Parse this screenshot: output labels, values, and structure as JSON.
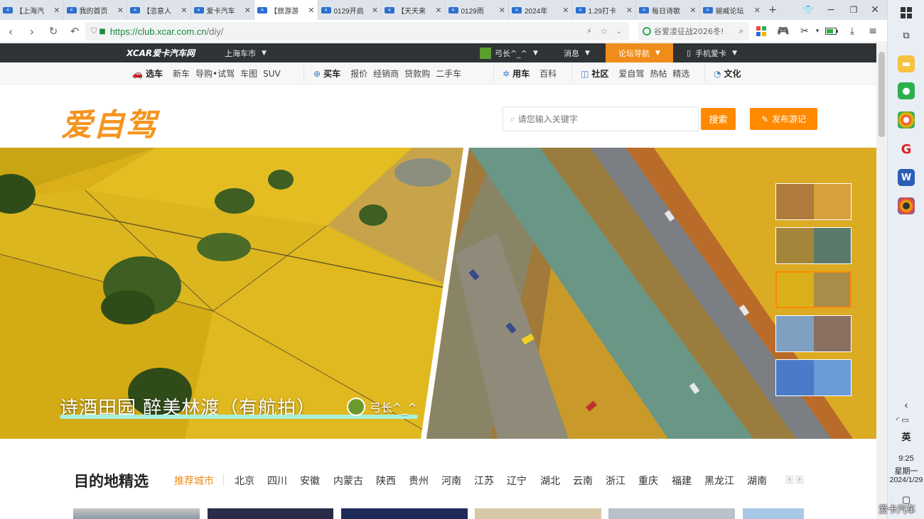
{
  "browser": {
    "tabs": [
      {
        "label": "【上海汽",
        "active": false
      },
      {
        "label": "我的首页",
        "active": false
      },
      {
        "label": "【恣意人",
        "active": false
      },
      {
        "label": "爱卡汽车",
        "active": false
      },
      {
        "label": "【旅游游",
        "active": true
      },
      {
        "label": "0129开启",
        "active": false
      },
      {
        "label": "【天天来",
        "active": false
      },
      {
        "label": "0129雨",
        "active": false
      },
      {
        "label": "2024年",
        "active": false
      },
      {
        "label": "1.29打卡",
        "active": false
      },
      {
        "label": "每日诗歌",
        "active": false
      },
      {
        "label": "骊威论坛",
        "active": false
      }
    ],
    "url_scheme_host": "https://club.xcar.com.cn",
    "url_path": "/diy/",
    "search_placeholder": "谷爱凌征战2026冬!"
  },
  "site": {
    "logo_text": "XCAR爱卡汽车网",
    "city": "上海车市",
    "user": "弓长^_^",
    "messages": "消息",
    "forum_nav": "论坛导航",
    "mobile": "手机爱卡",
    "categories": [
      {
        "head": "选车",
        "links": [
          "新车",
          "导购•试驾",
          "车图",
          "SUV"
        ]
      },
      {
        "head": "买车",
        "links": [
          "报价",
          "经销商",
          "贷款购",
          "二手车"
        ]
      },
      {
        "head": "用车",
        "links": [
          "百科"
        ]
      },
      {
        "head": "社区",
        "links": [
          "爱自驾",
          "热帖",
          "精选"
        ]
      },
      {
        "head": "文化",
        "links": []
      }
    ]
  },
  "header": {
    "brand": "爱自驾",
    "keyword_placeholder": "请您输入关键字",
    "search_btn": "搜索",
    "post_btn": "发布游记"
  },
  "hero": {
    "title": "诗酒田园 醉美林渡（有航拍）",
    "author": "弓长^_^",
    "selected_thumb_index": 2
  },
  "destinations": {
    "title": "目的地精选",
    "cities": [
      "推荐城市",
      "北京",
      "四川",
      "安徽",
      "内蒙古",
      "陕西",
      "贵州",
      "河南",
      "江苏",
      "辽宁",
      "湖北",
      "云南",
      "浙江",
      "重庆",
      "福建",
      "黑龙江",
      "湖南"
    ]
  },
  "system": {
    "ime": "英",
    "time": "9:25",
    "weekday": "星期一",
    "date": "2024/1/29",
    "watermark": "爱卡汽车"
  },
  "colors": {
    "accent": "#f08c19",
    "topbar": "#2f3336",
    "url_green": "#1a8a3a"
  }
}
